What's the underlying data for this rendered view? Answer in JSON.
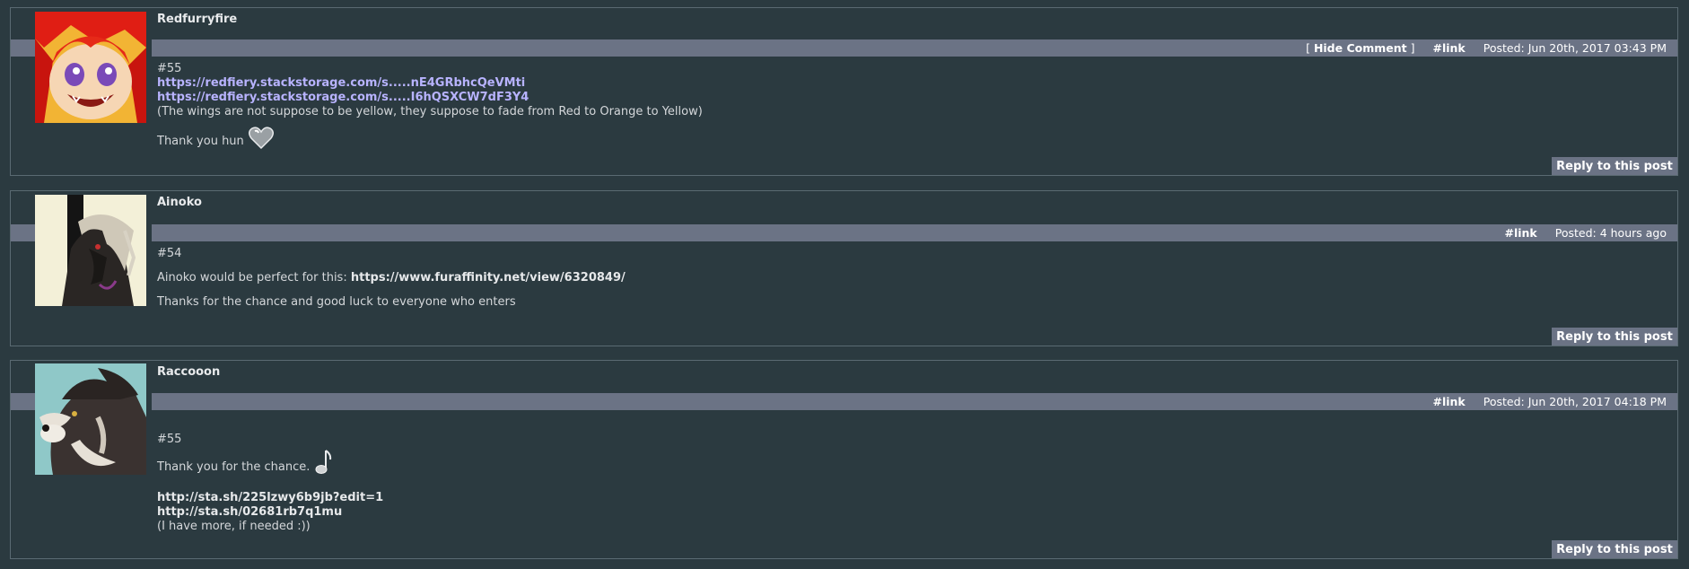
{
  "comments": [
    {
      "username": "Redfurryfire",
      "hide_comment": "Hide Comment",
      "hide_open": "[ ",
      "hide_close": " ]",
      "link_label": "#link",
      "posted": "Posted: Jun 20th, 2017 03:43 PM",
      "number": "#55",
      "links": [
        "https://redfiery.stackstorage.com/s.....nE4GRbhcQeVMti",
        "https://redfiery.stackstorage.com/s.....I6hQSXCW7dF3Y4"
      ],
      "note": "(The wings are not suppose to be yellow, they suppose to fade from Red to Orange to Yellow)",
      "thanks": "Thank you hun",
      "emote": "heart-icon",
      "reply": "Reply to this post",
      "avatar_colors": [
        "#e8281e",
        "#f4a020",
        "#7a4ab8"
      ]
    },
    {
      "username": "Ainoko",
      "link_label": "#link",
      "posted": "Posted: 4 hours ago",
      "number": "#54",
      "text_before": "Ainoko would be perfect for this: ",
      "inline_link": "https://www.furaffinity.net/view/6320849/",
      "thanks": "Thanks for the chance and good luck to everyone who enters",
      "reply": "Reply to this post"
    },
    {
      "username": "Raccooon",
      "link_label": "#link",
      "posted": "Posted: Jun 20th, 2017 04:18 PM",
      "number": "#55",
      "thanks": "Thank you for the chance.",
      "emote": "music-note-icon",
      "links": [
        "http://sta.sh/225lzwy6b9jb?edit=1",
        "http://sta.sh/02681rb7q1mu"
      ],
      "note": "(I have more, if needed :))",
      "reply": "Reply to this post"
    }
  ],
  "colors": {
    "background": "#2b3a40",
    "header_bar": "#6b7385",
    "link_purple": "#b8b3ff",
    "border": "#5a6a72"
  }
}
